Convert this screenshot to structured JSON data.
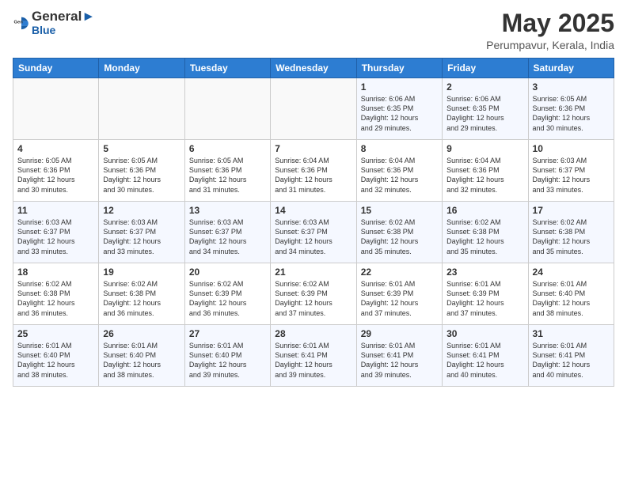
{
  "header": {
    "logo_line1": "General",
    "logo_line2": "Blue",
    "month": "May 2025",
    "location": "Perumpavur, Kerala, India"
  },
  "weekdays": [
    "Sunday",
    "Monday",
    "Tuesday",
    "Wednesday",
    "Thursday",
    "Friday",
    "Saturday"
  ],
  "weeks": [
    [
      {
        "day": "",
        "info": ""
      },
      {
        "day": "",
        "info": ""
      },
      {
        "day": "",
        "info": ""
      },
      {
        "day": "",
        "info": ""
      },
      {
        "day": "1",
        "info": "Sunrise: 6:06 AM\nSunset: 6:35 PM\nDaylight: 12 hours\nand 29 minutes."
      },
      {
        "day": "2",
        "info": "Sunrise: 6:06 AM\nSunset: 6:35 PM\nDaylight: 12 hours\nand 29 minutes."
      },
      {
        "day": "3",
        "info": "Sunrise: 6:05 AM\nSunset: 6:36 PM\nDaylight: 12 hours\nand 30 minutes."
      }
    ],
    [
      {
        "day": "4",
        "info": "Sunrise: 6:05 AM\nSunset: 6:36 PM\nDaylight: 12 hours\nand 30 minutes."
      },
      {
        "day": "5",
        "info": "Sunrise: 6:05 AM\nSunset: 6:36 PM\nDaylight: 12 hours\nand 30 minutes."
      },
      {
        "day": "6",
        "info": "Sunrise: 6:05 AM\nSunset: 6:36 PM\nDaylight: 12 hours\nand 31 minutes."
      },
      {
        "day": "7",
        "info": "Sunrise: 6:04 AM\nSunset: 6:36 PM\nDaylight: 12 hours\nand 31 minutes."
      },
      {
        "day": "8",
        "info": "Sunrise: 6:04 AM\nSunset: 6:36 PM\nDaylight: 12 hours\nand 32 minutes."
      },
      {
        "day": "9",
        "info": "Sunrise: 6:04 AM\nSunset: 6:36 PM\nDaylight: 12 hours\nand 32 minutes."
      },
      {
        "day": "10",
        "info": "Sunrise: 6:03 AM\nSunset: 6:37 PM\nDaylight: 12 hours\nand 33 minutes."
      }
    ],
    [
      {
        "day": "11",
        "info": "Sunrise: 6:03 AM\nSunset: 6:37 PM\nDaylight: 12 hours\nand 33 minutes."
      },
      {
        "day": "12",
        "info": "Sunrise: 6:03 AM\nSunset: 6:37 PM\nDaylight: 12 hours\nand 33 minutes."
      },
      {
        "day": "13",
        "info": "Sunrise: 6:03 AM\nSunset: 6:37 PM\nDaylight: 12 hours\nand 34 minutes."
      },
      {
        "day": "14",
        "info": "Sunrise: 6:03 AM\nSunset: 6:37 PM\nDaylight: 12 hours\nand 34 minutes."
      },
      {
        "day": "15",
        "info": "Sunrise: 6:02 AM\nSunset: 6:38 PM\nDaylight: 12 hours\nand 35 minutes."
      },
      {
        "day": "16",
        "info": "Sunrise: 6:02 AM\nSunset: 6:38 PM\nDaylight: 12 hours\nand 35 minutes."
      },
      {
        "day": "17",
        "info": "Sunrise: 6:02 AM\nSunset: 6:38 PM\nDaylight: 12 hours\nand 35 minutes."
      }
    ],
    [
      {
        "day": "18",
        "info": "Sunrise: 6:02 AM\nSunset: 6:38 PM\nDaylight: 12 hours\nand 36 minutes."
      },
      {
        "day": "19",
        "info": "Sunrise: 6:02 AM\nSunset: 6:38 PM\nDaylight: 12 hours\nand 36 minutes."
      },
      {
        "day": "20",
        "info": "Sunrise: 6:02 AM\nSunset: 6:39 PM\nDaylight: 12 hours\nand 36 minutes."
      },
      {
        "day": "21",
        "info": "Sunrise: 6:02 AM\nSunset: 6:39 PM\nDaylight: 12 hours\nand 37 minutes."
      },
      {
        "day": "22",
        "info": "Sunrise: 6:01 AM\nSunset: 6:39 PM\nDaylight: 12 hours\nand 37 minutes."
      },
      {
        "day": "23",
        "info": "Sunrise: 6:01 AM\nSunset: 6:39 PM\nDaylight: 12 hours\nand 37 minutes."
      },
      {
        "day": "24",
        "info": "Sunrise: 6:01 AM\nSunset: 6:40 PM\nDaylight: 12 hours\nand 38 minutes."
      }
    ],
    [
      {
        "day": "25",
        "info": "Sunrise: 6:01 AM\nSunset: 6:40 PM\nDaylight: 12 hours\nand 38 minutes."
      },
      {
        "day": "26",
        "info": "Sunrise: 6:01 AM\nSunset: 6:40 PM\nDaylight: 12 hours\nand 38 minutes."
      },
      {
        "day": "27",
        "info": "Sunrise: 6:01 AM\nSunset: 6:40 PM\nDaylight: 12 hours\nand 39 minutes."
      },
      {
        "day": "28",
        "info": "Sunrise: 6:01 AM\nSunset: 6:41 PM\nDaylight: 12 hours\nand 39 minutes."
      },
      {
        "day": "29",
        "info": "Sunrise: 6:01 AM\nSunset: 6:41 PM\nDaylight: 12 hours\nand 39 minutes."
      },
      {
        "day": "30",
        "info": "Sunrise: 6:01 AM\nSunset: 6:41 PM\nDaylight: 12 hours\nand 40 minutes."
      },
      {
        "day": "31",
        "info": "Sunrise: 6:01 AM\nSunset: 6:41 PM\nDaylight: 12 hours\nand 40 minutes."
      }
    ]
  ]
}
